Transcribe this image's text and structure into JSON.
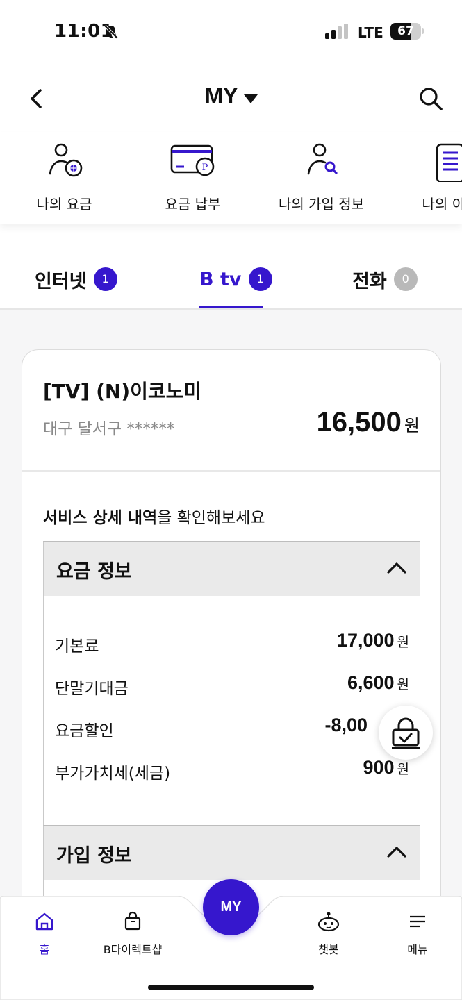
{
  "status_bar": {
    "time": "11:01",
    "network": "LTE",
    "battery": "67",
    "battery_level": 0.67
  },
  "header": {
    "title": "MY"
  },
  "quick_menu": [
    {
      "label": "나의 요금",
      "icon": "user-coin-icon"
    },
    {
      "label": "요금 납부",
      "icon": "card-point-icon"
    },
    {
      "label": "나의 가입 정보",
      "icon": "user-search-icon"
    },
    {
      "label": "나의 이용",
      "icon": "document-icon"
    }
  ],
  "tabs": [
    {
      "label": "인터넷",
      "count": "1",
      "active": false
    },
    {
      "label": "B tv",
      "count": "1",
      "active": true
    },
    {
      "label": "전화",
      "count": "0",
      "active": false
    }
  ],
  "plan": {
    "name": "[TV] (N)이코노미",
    "address": "대구 달서구 ******",
    "price": "16,500",
    "price_unit": "원"
  },
  "detail_prompt": {
    "bold": "서비스 상세 내역",
    "rest": "을 확인해보세요"
  },
  "fee_section": {
    "title": "요금 정보",
    "rows": [
      {
        "name": "기본료",
        "value": "17,000",
        "unit": "원"
      },
      {
        "name": "단말기대금",
        "value": "6,600",
        "unit": "원"
      },
      {
        "name": "요금할인",
        "value": "-8,00",
        "unit": ""
      },
      {
        "name": "부가가치세(세금)",
        "value": "900",
        "unit": "원"
      }
    ]
  },
  "join_section": {
    "title": "가입 정보"
  },
  "bottom_nav": {
    "home": "홈",
    "shop": "B다이렉트샵",
    "my": "MY",
    "chatbot": "챗봇",
    "menu": "메뉴"
  },
  "colors": {
    "accent": "#3617cd",
    "badge_inactive": "#b9b9b9",
    "section_header": "#eaeaea"
  }
}
